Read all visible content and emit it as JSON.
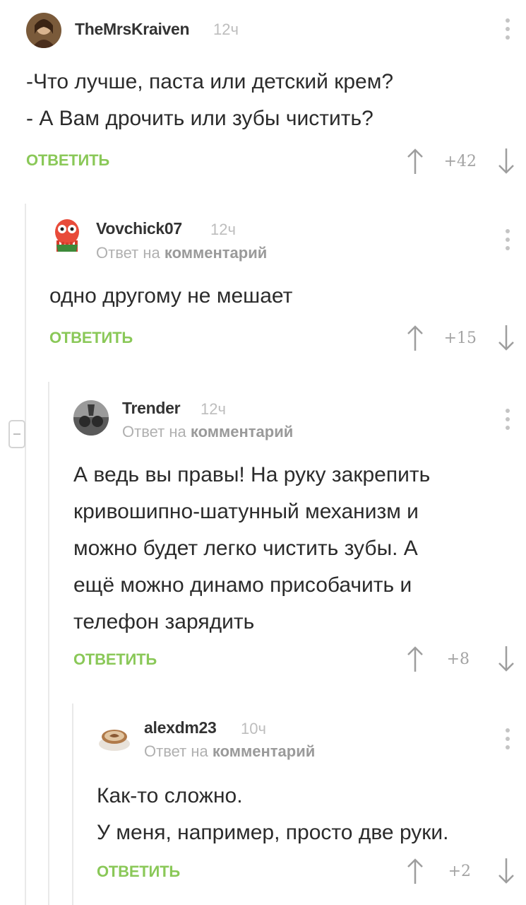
{
  "comments": [
    {
      "username": "TheMrsKraiven",
      "time": "12ч",
      "reply_to": "",
      "lines": [
        "-Что лучше, паста или детский крем?",
        "- А Вам дрочить или зубы чистить?"
      ],
      "reply_label": "ОТВЕТИТЬ",
      "score": "+42"
    },
    {
      "username": "Vovchick07",
      "time": "12ч",
      "reply_prefix": "Ответ на",
      "reply_target": "комментарий",
      "lines": [
        "одно другому не мешает"
      ],
      "reply_label": "ОТВЕТИТЬ",
      "score": "+15"
    },
    {
      "username": "Trender",
      "time": "12ч",
      "reply_prefix": "Ответ на",
      "reply_target": "комментарий",
      "lines": [
        "А ведь вы правы! На руку закрепить",
        "кривошипно-шатунный механизм и",
        "можно будет легко чистить зубы. А",
        "ещё можно динамо присобачить и",
        "телефон зарядить"
      ],
      "reply_label": "ОТВЕТИТЬ",
      "score": "+8"
    },
    {
      "username": "alexdm23",
      "time": "10ч",
      "reply_prefix": "Ответ на",
      "reply_target": "комментарий",
      "lines": [
        "Как-то сложно.",
        "У меня, например, просто две руки."
      ],
      "reply_label": "ОТВЕТИТЬ",
      "score": "+2"
    }
  ],
  "icons": {
    "upvote": "arrow-up-icon",
    "downvote": "arrow-down-icon",
    "more": "kebab-menu-icon",
    "collapse": "collapse-minus-icon"
  },
  "colors": {
    "accent_green": "#8ac858",
    "thread_line": "#e9e9e9",
    "muted": "#b0b0b0"
  }
}
